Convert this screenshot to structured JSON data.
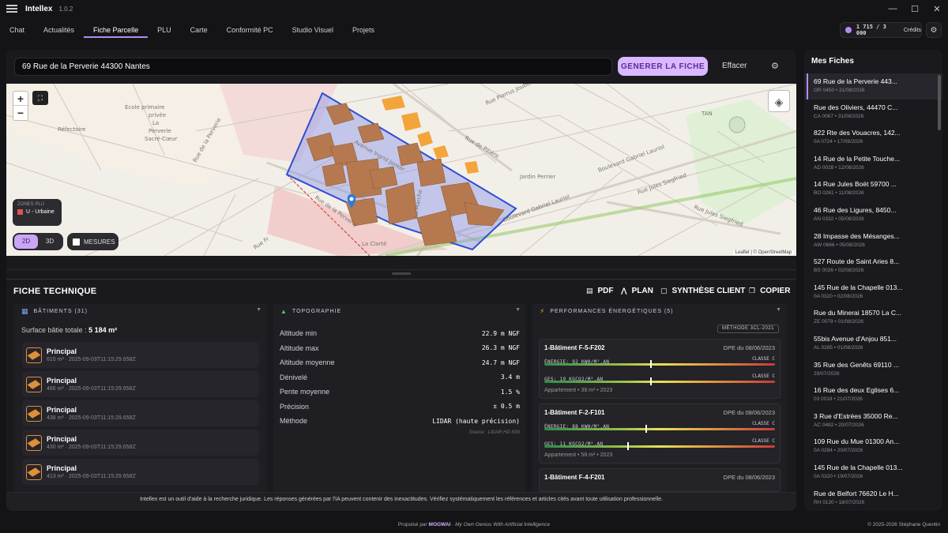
{
  "app": {
    "name": "Intellex",
    "version": "1.0.2"
  },
  "nav": {
    "tabs": [
      "Chat",
      "Actualités",
      "Fiche Parcelle",
      "PLU",
      "Carte",
      "Conformité PC",
      "Studio Visuel",
      "Projets"
    ],
    "active": 2
  },
  "credits": {
    "value": "1 715 / 3 000",
    "label": "Crédits"
  },
  "search": {
    "value": "69 Rue de la Perverie 44300 Nantes",
    "generate": "GENERER LA FICHE",
    "clear": "Effacer"
  },
  "map": {
    "legend_title": "ZONES PLU",
    "legend_item": "U - Urbaine",
    "modes": [
      "2D",
      "3D"
    ],
    "active_mode": "2D",
    "measures": "MESURES",
    "attribution": "Leaflet | © OpenStreetMap",
    "labels": [
      "École primaire",
      "privée",
      "La",
      "Perverie",
      "Sacré-Cœur",
      "Réfectoire",
      "Avenue Ingrid Jonker",
      "Rue Pierrus Joubert",
      "Rue de Pitière",
      "Boulevard Gabriel Lauriol",
      "Rue Jules Siegfried",
      "Rue de la Perverie",
      "La Marche",
      "TAN",
      "Jardin Perrier",
      "Rue Jules Siegfried",
      "Boulevard Gabriel Lauriol",
      "La Clarté",
      "Rue Fr",
      "Rue de la Perverie"
    ]
  },
  "fiche": {
    "title": "FICHE TECHNIQUE",
    "actions": [
      "PDF",
      "PLAN",
      "SYNTHÈSE CLIENT",
      "COPIER"
    ]
  },
  "batiments": {
    "header": "BÂTIMENTS (31)",
    "surface_label": "Surface bâtie totale :",
    "surface_value": "5 184 m²",
    "items": [
      {
        "name": "Principal",
        "sub": "610 m² · 2025-09-03T11:15:29.658Z"
      },
      {
        "name": "Principal",
        "sub": "466 m² · 2025-09-03T11:15:29.658Z"
      },
      {
        "name": "Principal",
        "sub": "438 m² · 2025-09-03T11:15:29.658Z"
      },
      {
        "name": "Principal",
        "sub": "430 m² · 2025-09-03T11:15:29.658Z"
      },
      {
        "name": "Principal",
        "sub": "413 m² · 2025-09-03T11:15:29.658Z"
      }
    ]
  },
  "topographie": {
    "header": "TOPOGRAPHIE",
    "rows": [
      {
        "label": "Altitude min",
        "value": "22.9 m NGF"
      },
      {
        "label": "Altitude max",
        "value": "26.3 m NGF"
      },
      {
        "label": "Altitude moyenne",
        "value": "24.7 m NGF"
      },
      {
        "label": "Dénivelé",
        "value": "3.4 m"
      },
      {
        "label": "Pente moyenne",
        "value": "1.5 %"
      },
      {
        "label": "Précision",
        "value": "± 0.5 m"
      },
      {
        "label": "Méthode",
        "value": "LIDAR (haute précision)"
      }
    ],
    "source": "Source : LIDAR HD IGN"
  },
  "performances": {
    "header": "PERFORMANCES ÉNERGÉTIQUES (5)",
    "method": "MÉTHODE 3CL-2021",
    "items": [
      {
        "name": "1-Bâtiment F-5-F202",
        "date": "DPE du 08/06/2023",
        "energie": "ÉNERGIE: 92 KWH/M².AN",
        "classe_e": "CLASSE C",
        "ges": "GES: 19 KGCO2/M².AN",
        "classe_g": "CLASSE C",
        "energie_level": 0.46,
        "ges_level": 0.46,
        "footer": "Appartement  •  39 m²  •  2023"
      },
      {
        "name": "1-Bâtiment F-2-F101",
        "date": "DPE du 08/06/2023",
        "energie": "ÉNERGIE: 88 KWH/M².AN",
        "classe_e": "CLASSE C",
        "ges": "GES: 11 KGCO2/M².AN",
        "classe_g": "CLASSE C",
        "energie_level": 0.44,
        "ges_level": 0.36,
        "footer": "Appartement  •  58 m²  •  2023"
      },
      {
        "name": "1-Bâtiment F-4-F201",
        "date": "DPE du 08/06/2023"
      }
    ]
  },
  "disclaimer": "Intellex est un outil d'aide à la recherche juridique. Les réponses générées par l'IA peuvent contenir des inexactitudes. Vérifiez systématiquement les références et articles cités avant toute utilisation professionnelle.",
  "footer": {
    "left": "Propulsé par",
    "brand": "MOGWAI",
    "tag": "My Own Genius With Artificial Intelligence",
    "right": "© 2025-2026 Stéphane Quentin"
  },
  "fiches": {
    "title": "Mes Fiches",
    "items": [
      {
        "addr": "69 Rue de la Perverie 443...",
        "meta": "OR 0450 • 31/08/2026"
      },
      {
        "addr": "Rue des Oliviers, 44470 C...",
        "meta": "CA 0067 • 31/08/2026"
      },
      {
        "addr": "822 Rte des Vouacres, 142...",
        "meta": "0A 0724 • 17/08/2026"
      },
      {
        "addr": "14 Rue de la Petite Touche...",
        "meta": "AD 0028 • 12/08/2026"
      },
      {
        "addr": "14 Rue Jules Boët 59700 ...",
        "meta": "BO 0261 • 11/08/2026"
      },
      {
        "addr": "46 Rue des Ligures, 8450...",
        "meta": "AN 0332 • 05/08/2026"
      },
      {
        "addr": "28 Impasse des Mésanges...",
        "meta": "AW 0666 • 05/08/2026"
      },
      {
        "addr": "527 Route de Saint Aries 8...",
        "meta": "BS 0026 • 02/08/2026"
      },
      {
        "addr": "145 Rue de la Chapelle 013...",
        "meta": "0A 0320 • 02/08/2026"
      },
      {
        "addr": "Rue du Minerai 18570 La C...",
        "meta": "ZE 0079 • 01/08/2026"
      },
      {
        "addr": "55bis Avenue d'Anjou 851...",
        "meta": "AL 0285 • 01/08/2026"
      },
      {
        "addr": "35 Rue des Genêts 69110 ...",
        "meta": "29/07/2026"
      },
      {
        "addr": "16 Rue des deux Eglises 6...",
        "meta": "03 0018 • 21/07/2026"
      },
      {
        "addr": "3 Rue d'Estrées 35000 Re...",
        "meta": "AC 0482 • 20/07/2026"
      },
      {
        "addr": "109 Rue du Mue 01300 An...",
        "meta": "0A 0284 • 20/07/2026"
      },
      {
        "addr": "145 Rue de la Chapelle 013...",
        "meta": "0A 0320 • 19/07/2026"
      },
      {
        "addr": "Rue de Belfort 76620 Le H...",
        "meta": "RH 0130 • 18/07/2026"
      }
    ]
  },
  "colors": {
    "accent": "#b48cf0",
    "parcel": "#3b5bdb",
    "building": "#c07a4f"
  }
}
